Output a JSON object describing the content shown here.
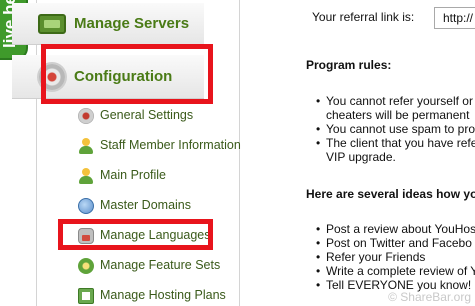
{
  "live_help": {
    "label": "live he"
  },
  "sidebar": {
    "sections": [
      {
        "label": "Manage Servers",
        "icon": "server-icon"
      },
      {
        "label": "Configuration",
        "icon": "gear-icon"
      }
    ],
    "items": [
      {
        "label": "General Settings",
        "icon": "gear-icon"
      },
      {
        "label": "Staff Member Information",
        "icon": "user-icon"
      },
      {
        "label": "Main Profile",
        "icon": "user-icon"
      },
      {
        "label": "Master Domains",
        "icon": "globe-icon"
      },
      {
        "label": "Manage Languages",
        "icon": "language-icon"
      },
      {
        "label": "Manage Feature Sets",
        "icon": "feature-icon"
      },
      {
        "label": "Manage Hosting Plans",
        "icon": "hosting-plan-icon"
      }
    ]
  },
  "highlight_color": "#e8141c",
  "content": {
    "referral_label": "Your referral link is:",
    "referral_value": "http://",
    "rules_heading": "Program rules:",
    "rules": [
      "You cannot refer yourself or",
      "cheaters will be permanent",
      "You cannot use spam to pro",
      "The client that you have refe",
      "VIP upgrade."
    ],
    "ideas_heading": "Here are several ideas how yo",
    "ideas": [
      "Post a review about YouHos",
      "Post on Twitter and Facebo",
      "Refer your Friends",
      "Write a complete review of Y",
      "Tell EVERYONE you know!"
    ]
  },
  "watermark": "© ShareBar.org"
}
